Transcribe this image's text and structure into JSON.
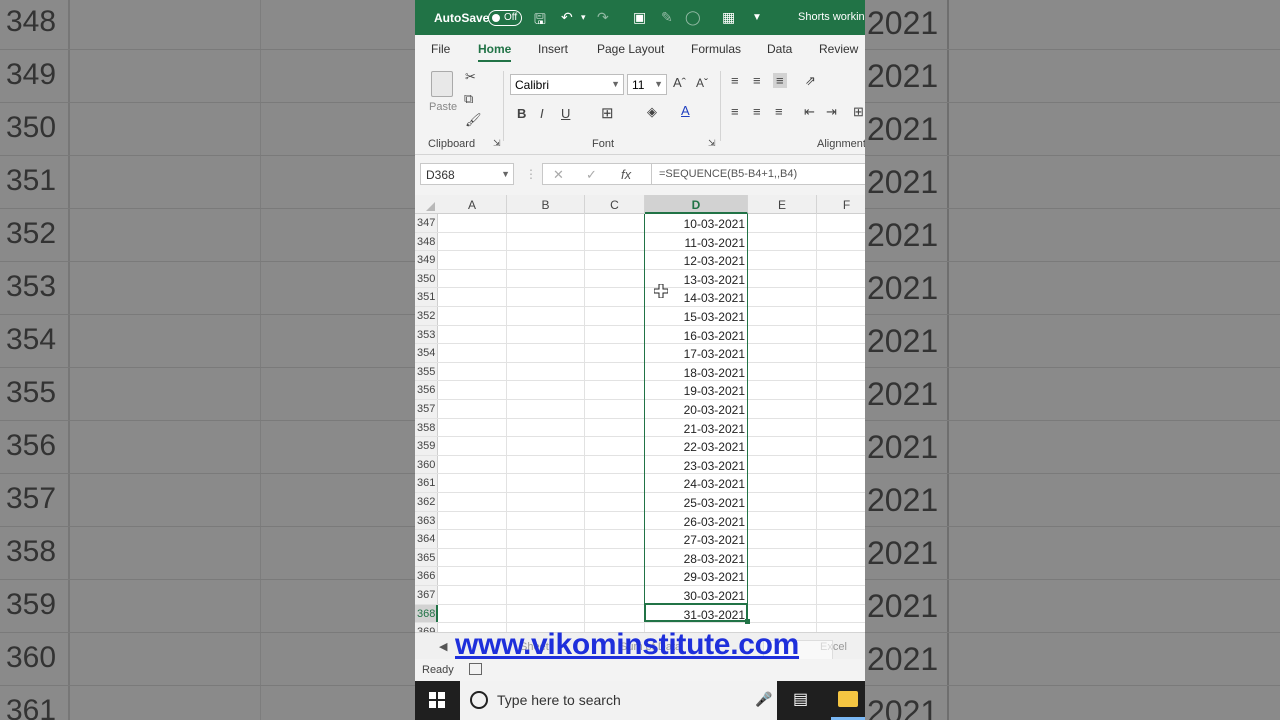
{
  "background": {
    "left_rows": [
      "348",
      "349",
      "350",
      "351",
      "352",
      "353",
      "354",
      "355",
      "356",
      "357",
      "358",
      "359",
      "360",
      "361"
    ],
    "right_value": "2021"
  },
  "titlebar": {
    "autosave_label": "AutoSave",
    "toggle_state": "Off",
    "document_title": "Shorts workin"
  },
  "tabs": [
    "File",
    "Home",
    "Insert",
    "Page Layout",
    "Formulas",
    "Data",
    "Review"
  ],
  "active_tab": "Home",
  "ribbon": {
    "paste_label": "Paste",
    "font_name": "Calibri",
    "font_size": "11",
    "bold": "B",
    "italic": "I",
    "underline": "U",
    "groups": {
      "clipboard": "Clipboard",
      "font": "Font",
      "alignment": "Alignment"
    }
  },
  "formula_bar": {
    "name_box": "D368",
    "fx": "fx",
    "formula": "=SEQUENCE(B5-B4+1,,B4)"
  },
  "columns": [
    "A",
    "B",
    "C",
    "D",
    "E",
    "F"
  ],
  "selected_column": "D",
  "rows": [
    {
      "num": "347",
      "d": "10-03-2021"
    },
    {
      "num": "348",
      "d": "11-03-2021"
    },
    {
      "num": "349",
      "d": "12-03-2021"
    },
    {
      "num": "350",
      "d": "13-03-2021"
    },
    {
      "num": "351",
      "d": "14-03-2021"
    },
    {
      "num": "352",
      "d": "15-03-2021"
    },
    {
      "num": "353",
      "d": "16-03-2021"
    },
    {
      "num": "354",
      "d": "17-03-2021"
    },
    {
      "num": "355",
      "d": "18-03-2021"
    },
    {
      "num": "356",
      "d": "19-03-2021"
    },
    {
      "num": "357",
      "d": "20-03-2021"
    },
    {
      "num": "358",
      "d": "21-03-2021"
    },
    {
      "num": "359",
      "d": "22-03-2021"
    },
    {
      "num": "360",
      "d": "23-03-2021"
    },
    {
      "num": "361",
      "d": "24-03-2021"
    },
    {
      "num": "362",
      "d": "25-03-2021"
    },
    {
      "num": "363",
      "d": "26-03-2021"
    },
    {
      "num": "364",
      "d": "27-03-2021"
    },
    {
      "num": "365",
      "d": "28-03-2021"
    },
    {
      "num": "366",
      "d": "29-03-2021"
    },
    {
      "num": "367",
      "d": "30-03-2021"
    },
    {
      "num": "368",
      "d": "31-03-2021"
    },
    {
      "num": "369",
      "d": ""
    }
  ],
  "selected_row": "368",
  "sheet_tabs": [
    "Sheet",
    "Sum of Data",
    "Excel"
  ],
  "watermark": "www.vikominstitute.com",
  "status": {
    "ready": "Ready"
  },
  "taskbar": {
    "search_placeholder": "Type here to search"
  },
  "colors": {
    "excel_green": "#217346",
    "watermark_blue": "#1e2fdb"
  }
}
